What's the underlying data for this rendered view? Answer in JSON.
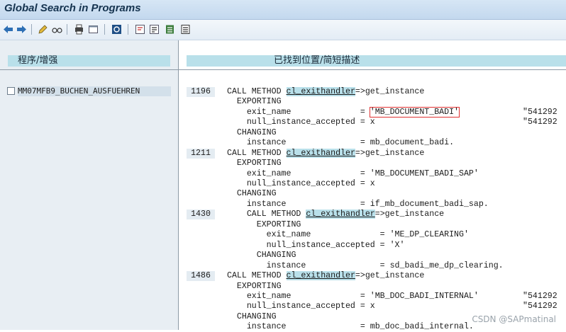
{
  "window": {
    "title": "Global Search in Programs"
  },
  "toolbar": {
    "icons": [
      "back-arrow-icon",
      "forward-arrow-icon",
      "edit-pencil-icon",
      "glasses-icon",
      "print-icon",
      "window-icon",
      "refresh-icon",
      "find-icon",
      "find-next-icon",
      "settings-icon",
      "list-icon"
    ]
  },
  "left": {
    "header": "程序/增强",
    "programs": [
      {
        "name": "MM07MFB9_BUCHEN_AUSFUEHREN",
        "checked": false
      }
    ]
  },
  "right": {
    "header": "已找到位置/简短描述",
    "hits": [
      {
        "line": "1196",
        "lines": [
          {
            "t": "CALL METHOD ",
            "cls": "cl_exithandler",
            "rest": "=>get_instance",
            "indent": 0
          },
          {
            "t": "  EXPORTING",
            "indent": 0
          },
          {
            "t": "    exit_name              = ",
            "lit": "'MB_DOCUMENT_BADI'",
            "boxed": true,
            "cmt": "\"541292",
            "indent": 0
          },
          {
            "t": "    null_instance_accepted = x",
            "cmt": "\"541292",
            "indent": 0
          },
          {
            "t": "  CHANGING",
            "indent": 0
          },
          {
            "t": "    instance               = mb_document_badi.",
            "indent": 0
          }
        ]
      },
      {
        "line": "1211",
        "lines": [
          {
            "t": "CALL METHOD ",
            "cls": "cl_exithandler",
            "rest": "=>get_instance"
          },
          {
            "t": "  EXPORTING"
          },
          {
            "t": "    exit_name              = 'MB_DOCUMENT_BADI_SAP'"
          },
          {
            "t": "    null_instance_accepted = x"
          },
          {
            "t": "  CHANGING"
          },
          {
            "t": "    instance               = if_mb_document_badi_sap."
          }
        ]
      },
      {
        "line": "1430",
        "lines": [
          {
            "t": "    CALL METHOD ",
            "cls": "cl_exithandler",
            "rest": "=>get_instance"
          },
          {
            "t": "      EXPORTING"
          },
          {
            "t": "        exit_name              = 'ME_DP_CLEARING'"
          },
          {
            "t": "        null_instance_accepted = 'X'"
          },
          {
            "t": "      CHANGING"
          },
          {
            "t": "        instance               = sd_badi_me_dp_clearing."
          }
        ]
      },
      {
        "line": "1486",
        "lines": [
          {
            "t": "CALL METHOD ",
            "cls": "cl_exithandler",
            "rest": "=>get_instance"
          },
          {
            "t": "  EXPORTING"
          },
          {
            "t": "    exit_name              = 'MB_DOC_BADI_INTERNAL'",
            "cmt": "\"541292"
          },
          {
            "t": "    null_instance_accepted = x",
            "cmt": "\"541292"
          },
          {
            "t": "  CHANGING"
          },
          {
            "t": "    instance               = mb_doc_badi_internal."
          }
        ]
      }
    ]
  },
  "watermark": "CSDN @SAPmatinal",
  "colors": {
    "highlight": "#b9e0ea",
    "box": "#e03030",
    "titlebar": "#c3d8ee"
  }
}
